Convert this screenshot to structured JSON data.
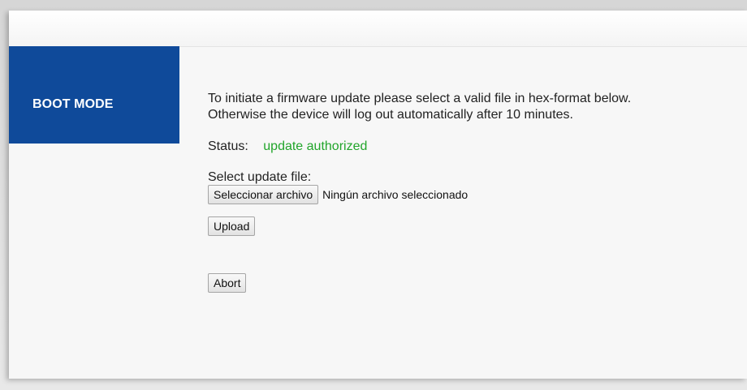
{
  "sidebar": {
    "title": "BOOT MODE"
  },
  "content": {
    "intro_line1": "To initiate a firmware update please select a valid file in hex-format below.",
    "intro_line2": "Otherwise the device will log out automatically after 10 minutes.",
    "status_label": "Status:",
    "status_value": "update authorized",
    "select_label": "Select update file:",
    "file_button_label": "Seleccionar archivo",
    "file_status": "Ningún archivo seleccionado",
    "upload_label": "Upload",
    "abort_label": "Abort"
  },
  "colors": {
    "sidebar_bg": "#0f4a9a",
    "status_ok": "#22a52b"
  }
}
